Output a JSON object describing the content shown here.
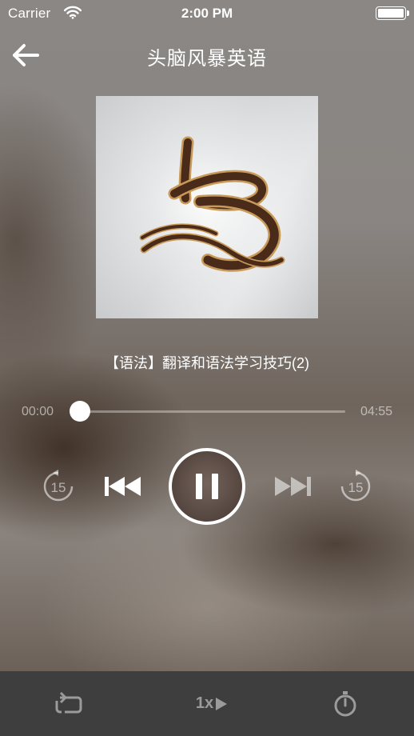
{
  "status_bar": {
    "carrier": "Carrier",
    "time": "2:00 PM",
    "wifi_icon": "wifi-icon",
    "battery_level": 1.0
  },
  "nav": {
    "title": "头脑风暴英语",
    "back_icon": "arrow-left-icon"
  },
  "now_playing": {
    "track_title": "【语法】翻译和语法学习技巧(2)",
    "current_time": "00:00",
    "duration": "04:55",
    "progress_fraction": 0.0
  },
  "controls": {
    "skip_back_seconds": "15",
    "skip_forward_seconds": "15",
    "state": "playing"
  },
  "toolbar": {
    "speed_label": "1x",
    "repeat_icon": "repeat-icon",
    "timer_icon": "stopwatch-icon"
  },
  "colors": {
    "toolbar_bg": "#3e3e3e",
    "toolbar_icon": "#9b9b9b",
    "logo_brown": "#4a2a18",
    "logo_gold": "#c89a5a"
  }
}
